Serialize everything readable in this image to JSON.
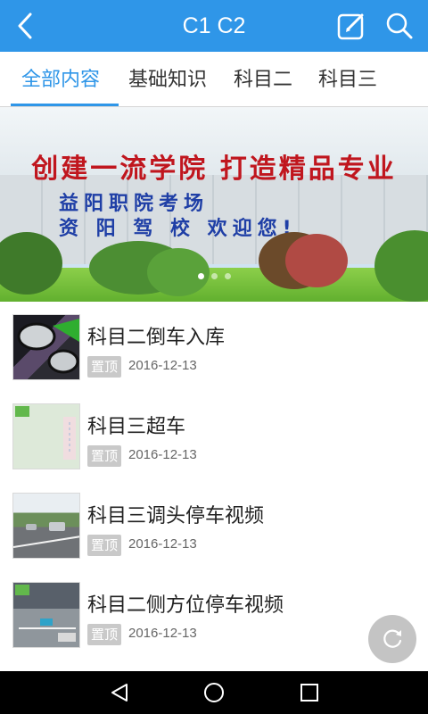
{
  "header": {
    "title": "C1 C2",
    "back_icon": "chevron-left-icon",
    "edit_icon": "edit-icon",
    "search_icon": "search-icon",
    "bg_color": "#2f96e8"
  },
  "tabs": [
    {
      "label": "全部内容",
      "active": true
    },
    {
      "label": "基础知识",
      "active": false
    },
    {
      "label": "科目二",
      "active": false
    },
    {
      "label": "科目三",
      "active": false
    }
  ],
  "banner": {
    "slogan": "创建一流学院 打造精品专业",
    "sign_line1": "益阳职院考场",
    "sign_line2": "资 阳 驾 校  欢迎您!",
    "slides_count": 3,
    "active_slide": 1
  },
  "list": [
    {
      "title": "科目二倒车入库",
      "tag": "置顶",
      "date": "2016-12-13"
    },
    {
      "title": "科目三超车",
      "tag": "置顶",
      "date": "2016-12-13"
    },
    {
      "title": "科目三调头停车视频",
      "tag": "置顶",
      "date": "2016-12-13"
    },
    {
      "title": "科目二侧方位停车视频",
      "tag": "置顶",
      "date": "2016-12-13"
    }
  ],
  "fab": {
    "icon": "refresh-icon"
  },
  "navbar": {
    "back_icon": "triangle-back-icon",
    "home_icon": "circle-home-icon",
    "recents_icon": "square-recents-icon"
  }
}
